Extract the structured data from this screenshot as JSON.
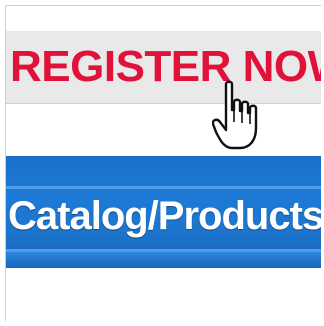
{
  "register": {
    "label": "REGISTER NOW",
    "color": "#e0123a"
  },
  "cursor": {
    "icon": "hand-pointer-icon"
  },
  "nav": {
    "catalog_label": "Catalog/Products",
    "bar_color": "#1d74cc"
  }
}
